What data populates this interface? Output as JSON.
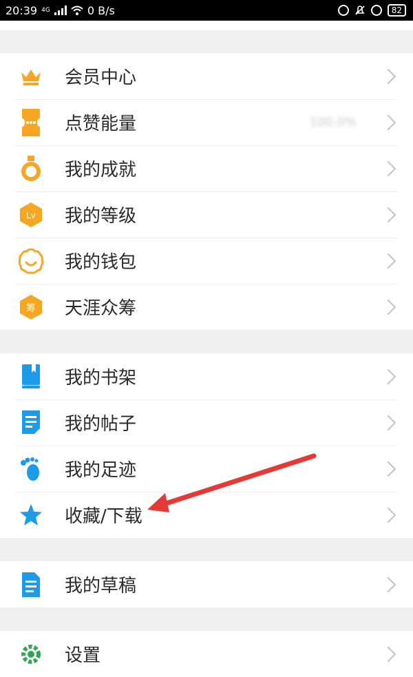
{
  "status_bar": {
    "time": "20:39",
    "network": "4G",
    "speed": "0 B/s",
    "battery": "82"
  },
  "menu": {
    "group1": [
      {
        "label": "会员中心",
        "icon": "crown-icon"
      },
      {
        "label": "点赞能量",
        "icon": "ticket-icon",
        "value": "100.0%"
      },
      {
        "label": "我的成就",
        "icon": "medal-icon"
      },
      {
        "label": "我的等级",
        "icon": "level-icon",
        "icon_text": "Lv"
      },
      {
        "label": "我的钱包",
        "icon": "wallet-icon"
      },
      {
        "label": "天涯众筹",
        "icon": "crowdfunding-icon",
        "icon_text": "筹"
      }
    ],
    "group2": [
      {
        "label": "我的书架",
        "icon": "bookshelf-icon"
      },
      {
        "label": "我的帖子",
        "icon": "posts-icon"
      },
      {
        "label": "我的足迹",
        "icon": "footprint-icon"
      },
      {
        "label": "收藏/下载",
        "icon": "star-icon"
      }
    ],
    "group3": [
      {
        "label": "我的草稿",
        "icon": "draft-icon"
      }
    ],
    "group4": [
      {
        "label": "设置",
        "icon": "settings-icon"
      }
    ]
  },
  "colors": {
    "orange": "#f5a623",
    "blue": "#1e9be8",
    "annotation_red": "#e53935"
  }
}
